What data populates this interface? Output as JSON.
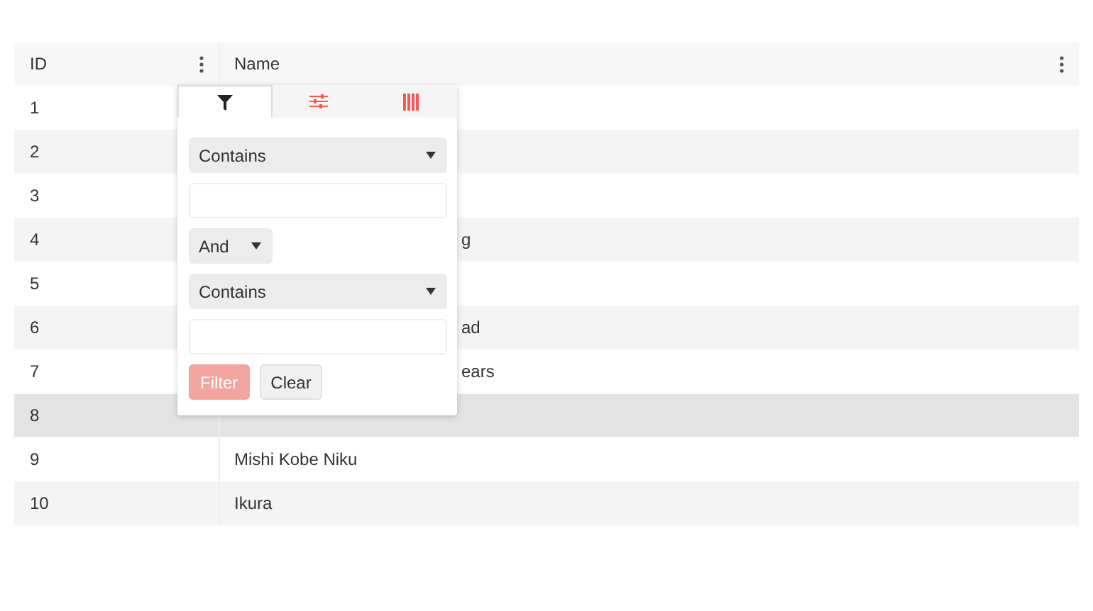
{
  "table": {
    "columns": [
      {
        "label": "ID"
      },
      {
        "label": "Name"
      }
    ],
    "rows": [
      {
        "id": "1",
        "selected": false
      },
      {
        "id": "2",
        "selected": false
      },
      {
        "id": "3",
        "selected": false
      },
      {
        "id": "4",
        "name": "g",
        "selected": false
      },
      {
        "id": "5",
        "selected": false
      },
      {
        "id": "6",
        "name": "ad",
        "selected": false
      },
      {
        "id": "7",
        "name": "ears",
        "selected": false
      },
      {
        "id": "8",
        "selected": true
      },
      {
        "id": "9",
        "name": "Mishi Kobe Niku",
        "selected": false
      },
      {
        "id": "10",
        "name": "Ikura",
        "selected": false
      }
    ]
  },
  "filter_menu": {
    "tabs": [
      {
        "kind": "filter",
        "selected": true
      },
      {
        "kind": "sliders",
        "selected": false
      },
      {
        "kind": "columns",
        "selected": false
      }
    ],
    "operator_1": "Contains",
    "logic": "And",
    "operator_2": "Contains",
    "buttons": [
      {
        "label": "Filter",
        "kind": "primary",
        "disabled": true
      },
      {
        "label": "Clear",
        "kind": "default",
        "disabled": false
      }
    ]
  }
}
